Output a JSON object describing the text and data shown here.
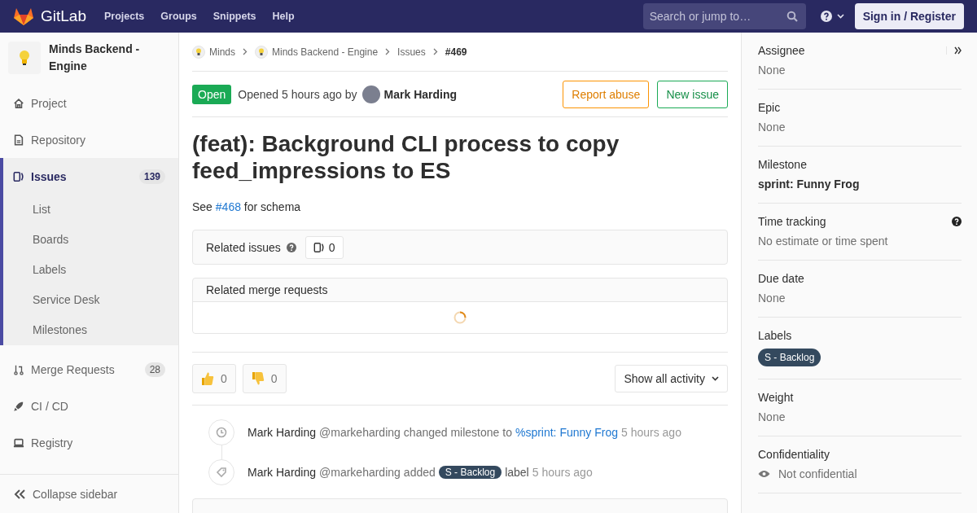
{
  "nav": {
    "brand": "GitLab",
    "links": [
      "Projects",
      "Groups",
      "Snippets",
      "Help"
    ],
    "search": {
      "placeholder": "Search or jump to…"
    },
    "sign_in": "Sign in / Register"
  },
  "sidebar": {
    "project_name": "Minds Backend - Engine",
    "items": [
      {
        "kind": "project",
        "label": "Project",
        "selected": false
      },
      {
        "kind": "repository",
        "label": "Repository",
        "selected": false
      },
      {
        "kind": "issues",
        "label": "Issues",
        "count": "139",
        "selected": true,
        "children": [
          {
            "label": "List"
          },
          {
            "label": "Boards"
          },
          {
            "label": "Labels"
          },
          {
            "label": "Service Desk"
          },
          {
            "label": "Milestones"
          }
        ]
      },
      {
        "kind": "merge",
        "label": "Merge Requests",
        "count": "28",
        "selected": false
      },
      {
        "kind": "cicd",
        "label": "CI / CD",
        "selected": false
      },
      {
        "kind": "registry",
        "label": "Registry",
        "selected": false
      }
    ],
    "collapse": "Collapse sidebar"
  },
  "breadcrumbs": [
    {
      "label": "Minds",
      "avatar": true
    },
    {
      "label": "Minds Backend - Engine",
      "avatar": true
    },
    {
      "label": "Issues",
      "avatar": false
    },
    {
      "label": "#469",
      "avatar": false
    }
  ],
  "issue": {
    "status": "Open",
    "opened": "Opened 5 hours ago by",
    "author": "Mark Harding",
    "buttons": [
      {
        "kind": "warning",
        "label": "Report abuse"
      },
      {
        "kind": "success",
        "label": "New issue"
      }
    ],
    "title": "(feat): Background CLI process to copy feed_impressions to ES",
    "description": {
      "before": "See",
      "link": "#468",
      "after": "for schema"
    }
  },
  "related_issues": {
    "title": "Related issues",
    "count": "0"
  },
  "related_merge_requests": {
    "title": "Related merge requests",
    "loading": true
  },
  "reactions": [
    {
      "kind": "thumbsup",
      "count": "0"
    },
    {
      "kind": "thumbsdown",
      "count": "0"
    }
  ],
  "activity_filter": "Show all activity",
  "notes": [
    {
      "kind": "milestone",
      "author": "Mark Harding",
      "username": "@markeharding",
      "action": "changed milestone to",
      "link": "%sprint: Funny Frog",
      "time": "5 hours ago"
    },
    {
      "kind": "label",
      "author": "Mark Harding",
      "username": "@markeharding",
      "action": "added",
      "label": "S - Backlog",
      "after": "label",
      "time": "5 hours ago"
    }
  ],
  "right_sidebar": [
    {
      "kind": "plain",
      "title": "Assignee",
      "value": "None"
    },
    {
      "kind": "plain",
      "title": "Epic",
      "value": "None"
    },
    {
      "kind": "bold",
      "title": "Milestone",
      "value": "sprint: Funny Frog"
    },
    {
      "kind": "help",
      "title": "Time tracking",
      "value": "No estimate or time spent"
    },
    {
      "kind": "plain",
      "title": "Due date",
      "value": "None"
    },
    {
      "kind": "label",
      "title": "Labels",
      "value": "S - Backlog"
    },
    {
      "kind": "plain",
      "title": "Weight",
      "value": "None"
    },
    {
      "kind": "eye",
      "title": "Confidentiality",
      "value": "Not confidential"
    }
  ]
}
